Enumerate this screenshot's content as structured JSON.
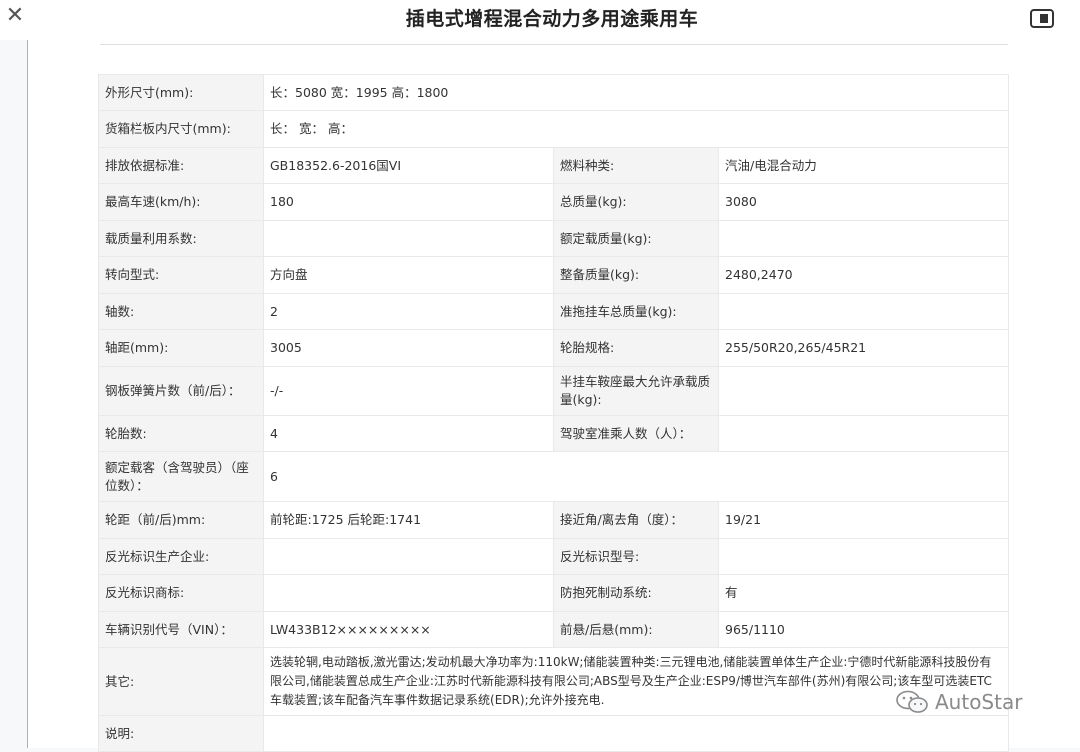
{
  "header": {
    "close_icon": "close-icon",
    "title": "插电式增程混合动力多用途乘用车",
    "reader_icon": "reader-mode-icon"
  },
  "spec_rows": [
    {
      "l1": "外形尺寸(mm):",
      "v1": "长：5080 宽：1995 高：1800"
    },
    {
      "l1": "货箱栏板内尺寸(mm):",
      "v1": "长：  宽：  高："
    },
    {
      "l1": "排放依据标准:",
      "v1": "GB18352.6-2016国VI",
      "l2": "燃料种类:",
      "v2": "汽油/电混合动力"
    },
    {
      "l1": "最高车速(km/h):",
      "v1": "180",
      "l2": "总质量(kg):",
      "v2": "3080"
    },
    {
      "l1": "载质量利用系数:",
      "v1": "",
      "l2": "额定载质量(kg):",
      "v2": ""
    },
    {
      "l1": "转向型式:",
      "v1": "方向盘",
      "l2": "整备质量(kg):",
      "v2": "2480,2470"
    },
    {
      "l1": "轴数:",
      "v1": "2",
      "l2": "准拖挂车总质量(kg):",
      "v2": ""
    },
    {
      "l1": "轴距(mm):",
      "v1": "3005",
      "l2": "轮胎规格:",
      "v2": "255/50R20,265/45R21"
    },
    {
      "l1": "钢板弹簧片数（前/后）：",
      "v1": "-/-",
      "l2": "半挂车鞍座最大允许承载质量(kg):",
      "v2": ""
    },
    {
      "l1": "轮胎数:",
      "v1": "4",
      "l2": "驾驶室准乘人数（人）：",
      "v2": ""
    },
    {
      "l1": "额定载客（含驾驶员）（座位数）：",
      "v1": "6"
    },
    {
      "l1": "轮距（前/后)mm:",
      "v1": "前轮距:1725 后轮距:1741",
      "l2": "接近角/离去角（度）：",
      "v2": "19/21"
    },
    {
      "l1": "反光标识生产企业:",
      "v1": "",
      "l2": "反光标识型号:",
      "v2": ""
    },
    {
      "l1": "反光标识商标:",
      "v1": "",
      "l2": "防抱死制动系统:",
      "v2": "有"
    },
    {
      "l1": "车辆识别代号（VIN）：",
      "v1": "LW433B12×××××××××",
      "l2": "前悬/后悬(mm):",
      "v2": "965/1110"
    },
    {
      "l1": "其它:",
      "v1": "选装轮辋,电动踏板,激光雷达;发动机最大净功率为:110kW;储能装置种类:三元锂电池,储能装置单体生产企业:宁德时代新能源科技股份有限公司,储能装置总成生产企业:江苏时代新能源科技有限公司;ABS型号及生产企业:ESP9/博世汽车部件(苏州)有限公司;该车型可选装ETC车载装置;该车配备汽车事件数据记录系统(EDR);允许外接充电."
    },
    {
      "l1": "说明:",
      "v1": ""
    }
  ],
  "watermark": {
    "icon": "wechat-icon",
    "text": "AutoStar"
  }
}
